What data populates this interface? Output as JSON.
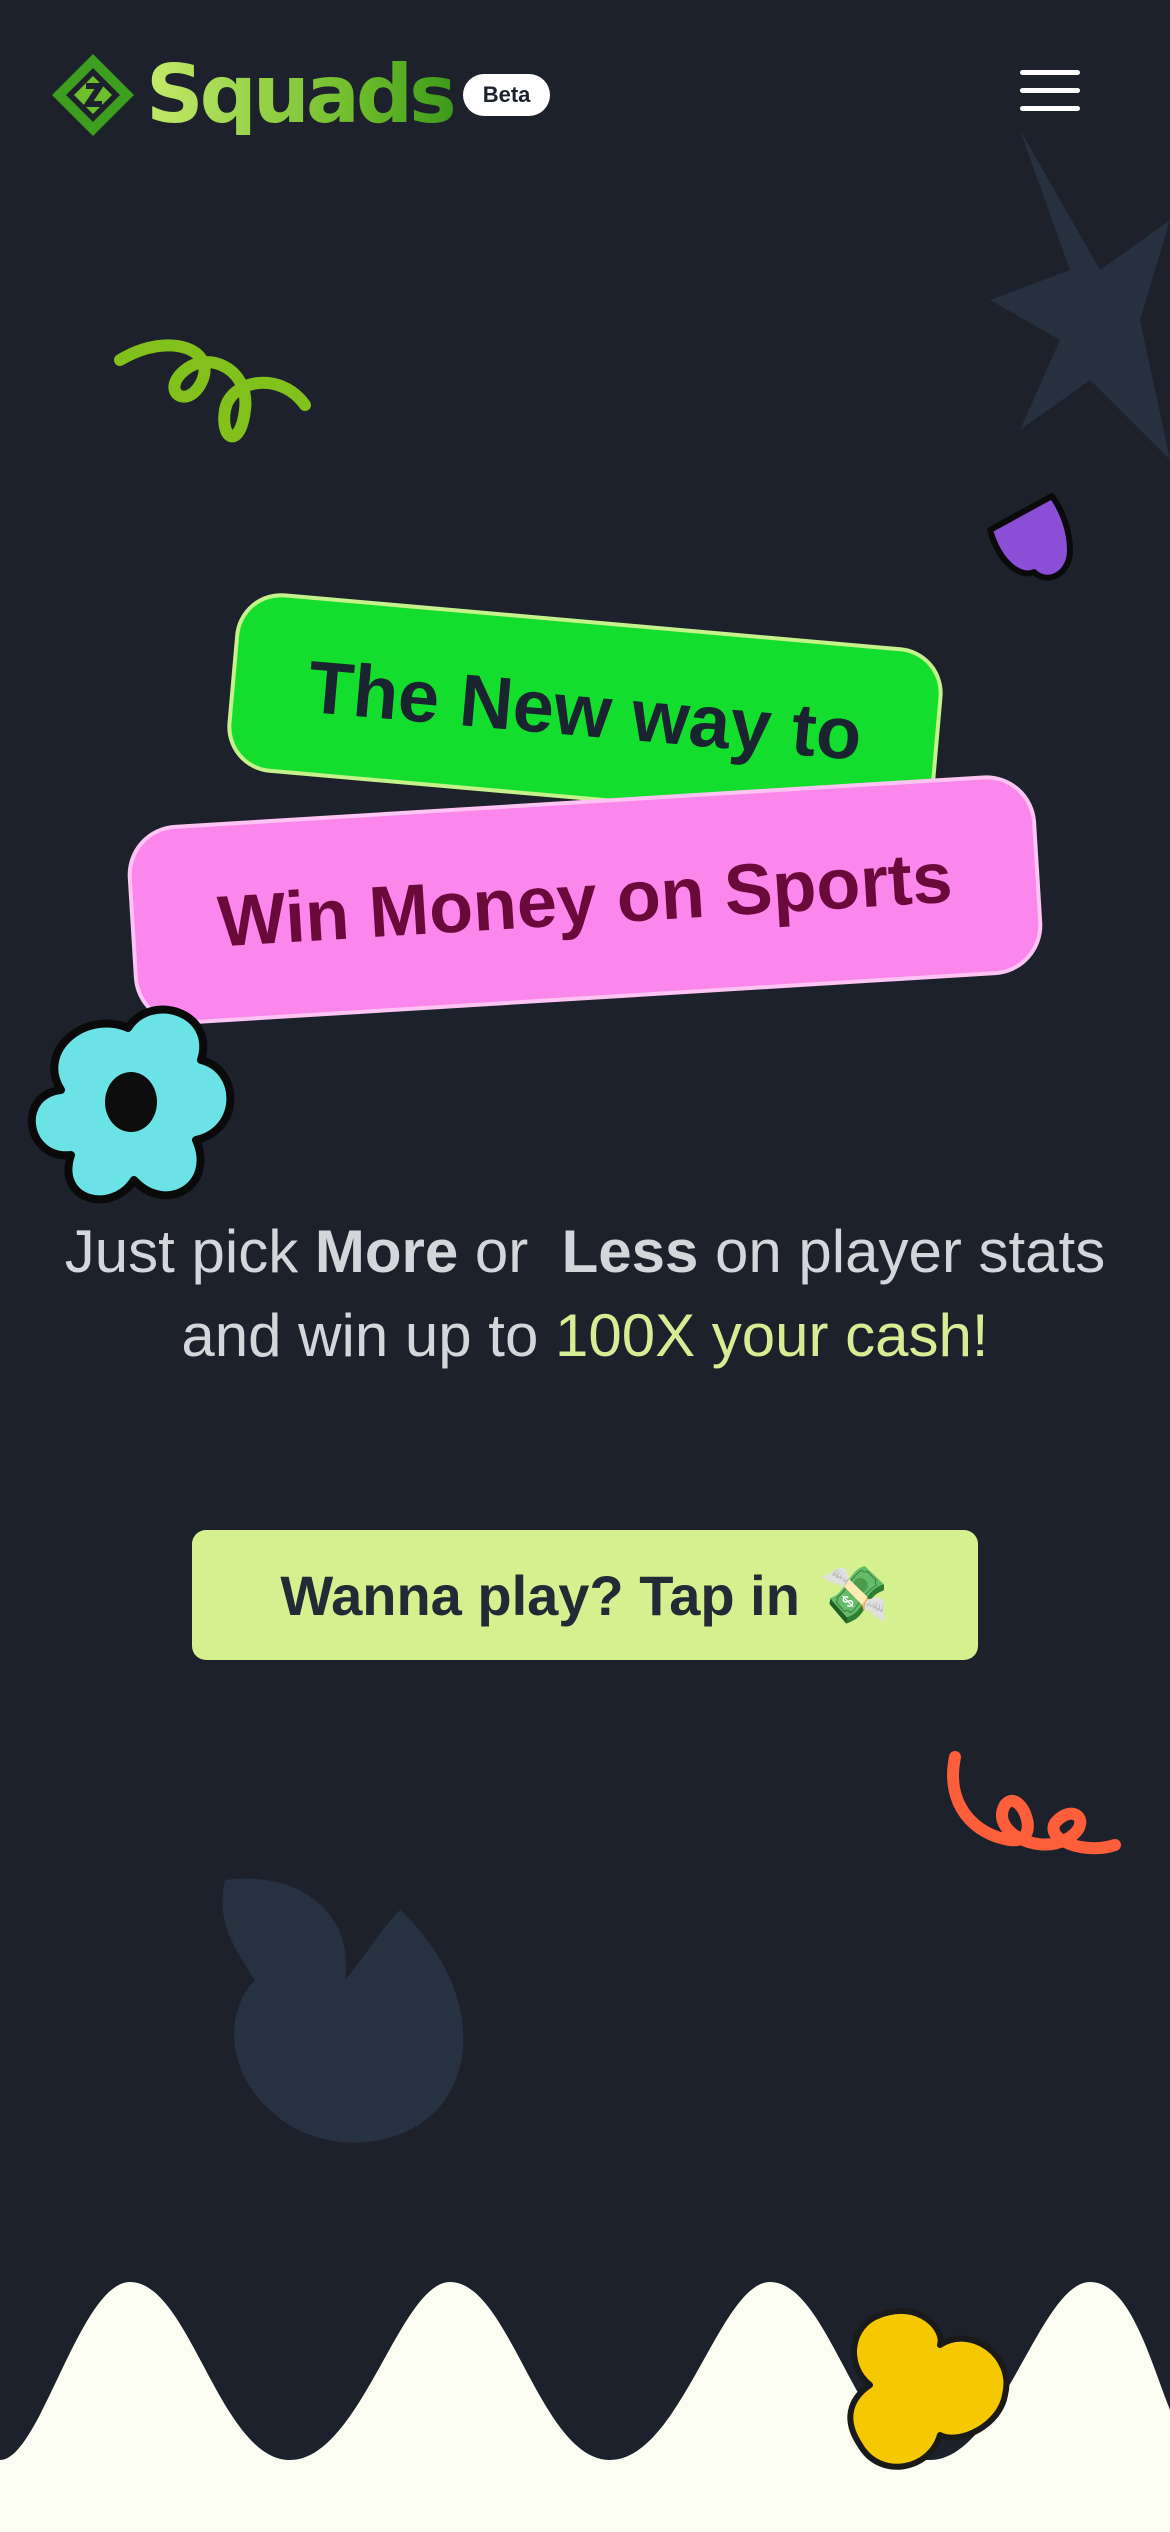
{
  "header": {
    "brand": "Squads",
    "badge": "Beta",
    "menu_icon": "hamburger-menu-icon"
  },
  "hero": {
    "line1": "The New way to",
    "line2": "Win Money on Sports"
  },
  "copy": {
    "part1": "Just pick ",
    "more": "More",
    "part2": " or  ",
    "less": "Less",
    "part3": " on player stats and win up to ",
    "highlight": "100X your cash!"
  },
  "cta": {
    "label": "Wanna play? Tap in",
    "emoji": "💸"
  },
  "colors": {
    "background": "#1c212c",
    "green_pill": "#14de2d",
    "pink_pill": "#fb86ec",
    "cta": "#d4f08f",
    "accent_text": "#d5ee93"
  }
}
